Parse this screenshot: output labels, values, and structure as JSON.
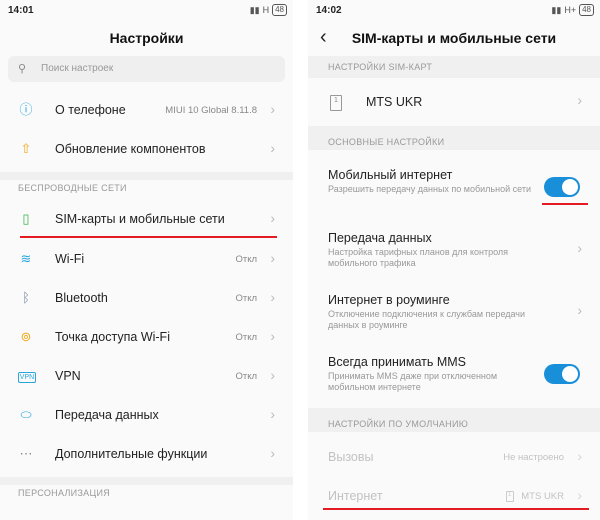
{
  "left": {
    "status": {
      "time": "14:01",
      "network": "H",
      "battery": "48"
    },
    "title": "Настройки",
    "search": {
      "placeholder": "Поиск настроек"
    },
    "top_items": [
      {
        "label": "О телефоне",
        "value": "MIUI 10 Global 8.11.8",
        "icon": "info-icon"
      },
      {
        "label": "Обновление компонентов",
        "value": "",
        "icon": "update-icon"
      }
    ],
    "wireless_section": "БЕСПРОВОДНЫЕ СЕТИ",
    "wireless_items": [
      {
        "label": "SIM-карты и мобильные сети",
        "value": "",
        "icon": "sim-icon"
      },
      {
        "label": "Wi-Fi",
        "value": "Откл",
        "icon": "wifi-icon"
      },
      {
        "label": "Bluetooth",
        "value": "Откл",
        "icon": "bluetooth-icon"
      },
      {
        "label": "Точка доступа Wi-Fi",
        "value": "Откл",
        "icon": "hotspot-icon"
      },
      {
        "label": "VPN",
        "value": "Откл",
        "icon": "vpn-icon"
      },
      {
        "label": "Передача данных",
        "value": "",
        "icon": "data-icon"
      },
      {
        "label": "Дополнительные функции",
        "value": "",
        "icon": "more-icon"
      }
    ],
    "personal_section": "ПЕРСОНАЛИЗАЦИЯ",
    "icon_glyphs": {
      "info": "ⓘ",
      "update": "⇧",
      "sim": "▯",
      "wifi": "≋",
      "bluetooth": "ᛒ",
      "hotspot": "⊚",
      "vpn": "VPN",
      "data": "⬭",
      "more": "⋯"
    },
    "chevron": "›"
  },
  "right": {
    "status": {
      "time": "14:02",
      "network": "H+",
      "battery": "48"
    },
    "back": "‹",
    "title": "SIM-карты и мобильные сети",
    "sim_section": "НАСТРОЙКИ SIM-КАРТ",
    "sim_name": "MTS UKR",
    "sim_number": "1",
    "basic_section": "ОСНОВНЫЕ НАСТРОЙКИ",
    "mobile_internet": {
      "title": "Мобильный интернет",
      "subtitle": "Разрешить передачу данных по мобильной сети",
      "enabled": true
    },
    "data_transfer": {
      "title": "Передача данных",
      "subtitle": "Настройка тарифных планов для контроля мобильного трафика"
    },
    "roaming": {
      "title": "Интернет в роуминге",
      "subtitle": "Отключение подключения к службам передачи данных в роуминге"
    },
    "mms": {
      "title": "Всегда принимать MMS",
      "subtitle": "Принимать MMS даже при отключенном мобильном интернете",
      "enabled": true
    },
    "default_section": "НАСТРОЙКИ ПО УМОЛЧАНИЮ",
    "calls": {
      "title": "Вызовы",
      "value": "Не настроено"
    },
    "internet": {
      "title": "Интернет",
      "value": "MTS UKR",
      "sim_number": "1"
    },
    "chevron": "›"
  },
  "colors": {
    "accent": "#1a8fd9",
    "highlight": "#e31b23"
  }
}
